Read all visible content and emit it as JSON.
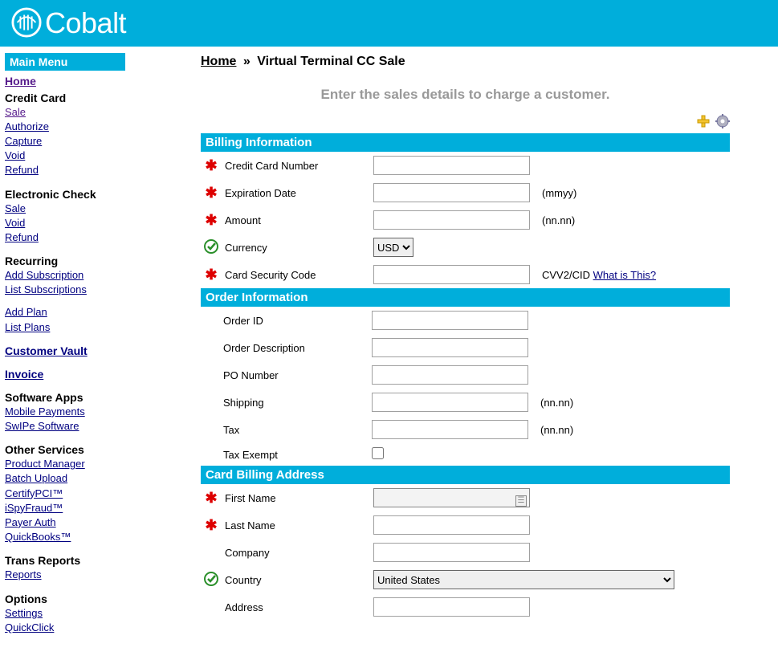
{
  "brand": "Cobalt",
  "sidebar": {
    "header": "Main Menu",
    "home": "Home",
    "groups": [
      {
        "heading": "Credit Card",
        "links": [
          "Sale",
          "Authorize",
          "Capture",
          "Void",
          "Refund"
        ]
      },
      {
        "heading": "Electronic Check",
        "links": [
          "Sale",
          "Void",
          "Refund"
        ]
      },
      {
        "heading": "Recurring",
        "links": [
          "Add Subscription",
          "List Subscriptions"
        ]
      },
      {
        "heading": "",
        "links": [
          "Add Plan",
          "List Plans"
        ]
      },
      {
        "heading_link": "Customer Vault"
      },
      {
        "heading_link": "Invoice"
      },
      {
        "heading": "Software Apps",
        "links": [
          "Mobile Payments",
          "SwIPe Software"
        ]
      },
      {
        "heading": "Other Services",
        "links": [
          "Product Manager",
          "Batch Upload",
          "CertifyPCI™",
          "iSpyFraud™",
          "Payer Auth",
          "QuickBooks™"
        ]
      },
      {
        "heading": "Trans Reports",
        "links": [
          "Reports"
        ]
      },
      {
        "heading": "Options",
        "links": [
          "Settings",
          "QuickClick"
        ]
      }
    ]
  },
  "breadcrumb": {
    "home": "Home",
    "sep": "»",
    "current": "Virtual Terminal CC Sale"
  },
  "subtitle": "Enter the sales details to charge a customer.",
  "sections": {
    "billing_header": "Billing Information",
    "order_header": "Order Information",
    "address_header": "Card Billing Address"
  },
  "fields": {
    "cc_number": {
      "label": "Credit Card Number"
    },
    "exp_date": {
      "label": "Expiration Date",
      "hint": "(mmyy)"
    },
    "amount": {
      "label": "Amount",
      "hint": "(nn.nn)"
    },
    "currency": {
      "label": "Currency",
      "value": "USD"
    },
    "csc": {
      "label": "Card Security Code",
      "hint_prefix": "CVV2/CID ",
      "hint_link": "What is This?"
    },
    "order_id": {
      "label": "Order ID"
    },
    "order_desc": {
      "label": "Order Description"
    },
    "po_number": {
      "label": "PO Number"
    },
    "shipping": {
      "label": "Shipping",
      "hint": "(nn.nn)"
    },
    "tax": {
      "label": "Tax",
      "hint": "(nn.nn)"
    },
    "tax_exempt": {
      "label": "Tax Exempt"
    },
    "first_name": {
      "label": "First Name"
    },
    "last_name": {
      "label": "Last Name"
    },
    "company": {
      "label": "Company"
    },
    "country": {
      "label": "Country",
      "value": "United States"
    },
    "address": {
      "label": "Address"
    }
  }
}
